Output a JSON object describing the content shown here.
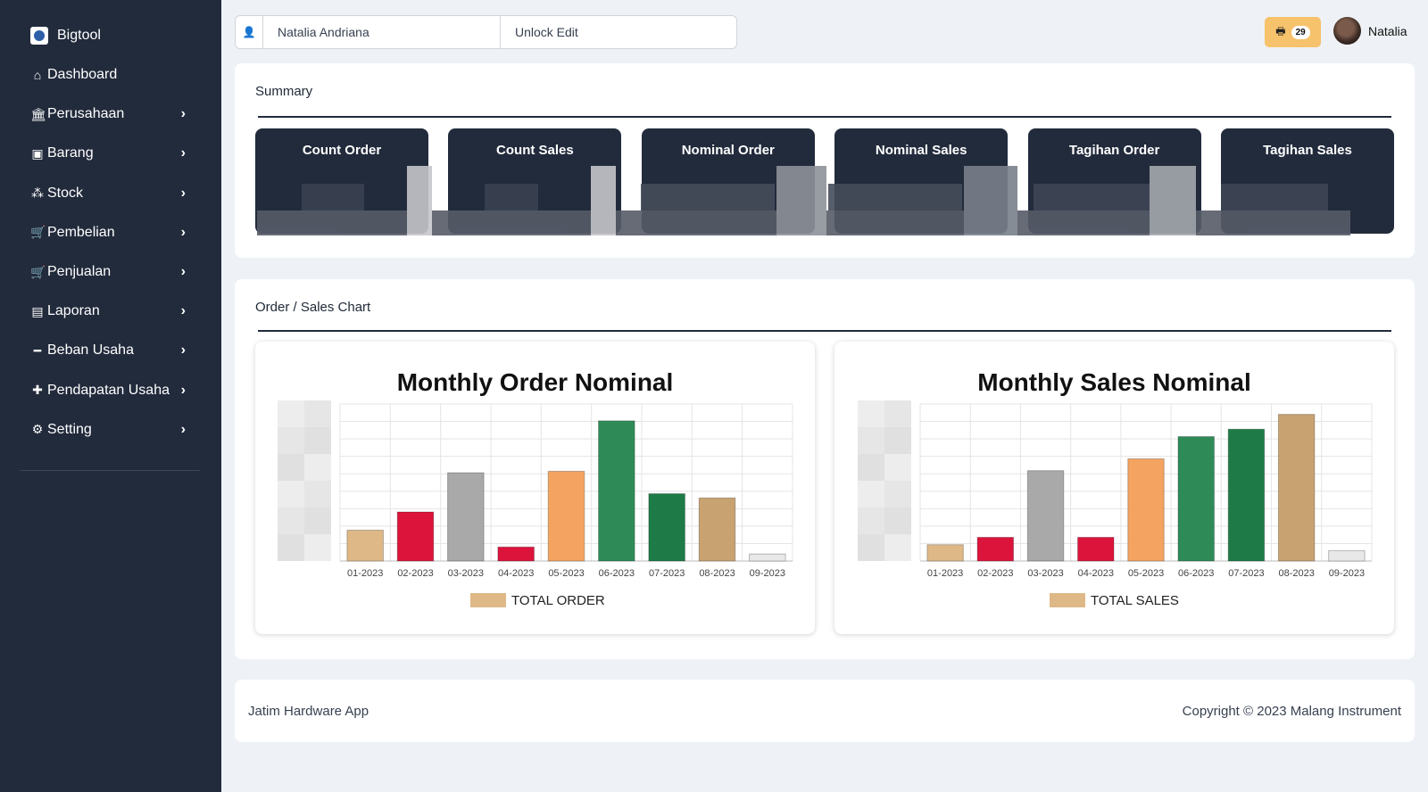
{
  "sidebar": {
    "brand": "Bigtool",
    "items": [
      {
        "label": "Dashboard",
        "icon": "home-icon",
        "glyph": "⌂",
        "chevron": false
      },
      {
        "label": "Perusahaan",
        "icon": "bank-icon",
        "glyph": "🏛",
        "chevron": true
      },
      {
        "label": "Barang",
        "icon": "box-icon",
        "glyph": "▣",
        "chevron": true
      },
      {
        "label": "Stock",
        "icon": "cubes-icon",
        "glyph": "⁂",
        "chevron": true
      },
      {
        "label": "Pembelian",
        "icon": "cart-icon",
        "glyph": "🛒",
        "chevron": true
      },
      {
        "label": "Penjualan",
        "icon": "cart-plus-icon",
        "glyph": "🛒",
        "chevron": true
      },
      {
        "label": "Laporan",
        "icon": "book-icon",
        "glyph": "▤",
        "chevron": true
      },
      {
        "label": "Beban Usaha",
        "icon": "minus-icon",
        "glyph": "━",
        "chevron": true
      },
      {
        "label": "Pendapatan Usaha",
        "icon": "plus-icon",
        "glyph": "✚",
        "chevron": true
      },
      {
        "label": "Setting",
        "icon": "gears-icon",
        "glyph": "⚙",
        "chevron": true
      }
    ]
  },
  "topbar": {
    "user_field": "Natalia Andriana",
    "unlock_label": "Unlock Edit",
    "notification_count": "29",
    "user_name": "Natalia"
  },
  "summary": {
    "title": "Summary",
    "tiles": [
      "Count Order",
      "Count Sales",
      "Nominal Order",
      "Nominal Sales",
      "Tagihan Order",
      "Tagihan Sales"
    ]
  },
  "charts_section": {
    "title": "Order / Sales Chart"
  },
  "chart_data": [
    {
      "type": "bar",
      "title": "Monthly Order Nominal",
      "categories": [
        "01-2023",
        "02-2023",
        "03-2023",
        "04-2023",
        "05-2023",
        "06-2023",
        "07-2023",
        "08-2023",
        "09-2023"
      ],
      "series": [
        {
          "name": "TOTAL ORDER",
          "values": [
            22,
            35,
            63,
            10,
            64,
            100,
            48,
            45,
            5
          ]
        }
      ],
      "colors": [
        "#deb887",
        "#dc143c",
        "#a9a9a9",
        "#dc143c",
        "#f4a460",
        "#2e8b57",
        "#1e7b47",
        "#c8a270",
        "#e8e8e8"
      ],
      "legend_color": "#deb887",
      "ylim": [
        0,
        112
      ],
      "grid": true,
      "legend": "bottom"
    },
    {
      "type": "bar",
      "title": "Monthly Sales Nominal",
      "categories": [
        "01-2023",
        "02-2023",
        "03-2023",
        "04-2023",
        "05-2023",
        "06-2023",
        "07-2023",
        "08-2023",
        "09-2023"
      ],
      "series": [
        {
          "name": "TOTAL SALES",
          "values": [
            11,
            16,
            61,
            16,
            69,
            84,
            89,
            99,
            7
          ]
        }
      ],
      "colors": [
        "#deb887",
        "#dc143c",
        "#a9a9a9",
        "#dc143c",
        "#f4a460",
        "#2e8b57",
        "#1e7b47",
        "#c8a270",
        "#e8e8e8"
      ],
      "legend_color": "#deb887",
      "ylim": [
        0,
        106
      ],
      "grid": true,
      "legend": "bottom"
    }
  ],
  "footer": {
    "left": "Jatim Hardware App",
    "right": "Copyright © 2023 Malang Instrument"
  },
  "colors": {
    "sidebar_bg": "#222b3c",
    "page_bg": "#eef2f6",
    "notification_bg": "#f6c26b"
  }
}
